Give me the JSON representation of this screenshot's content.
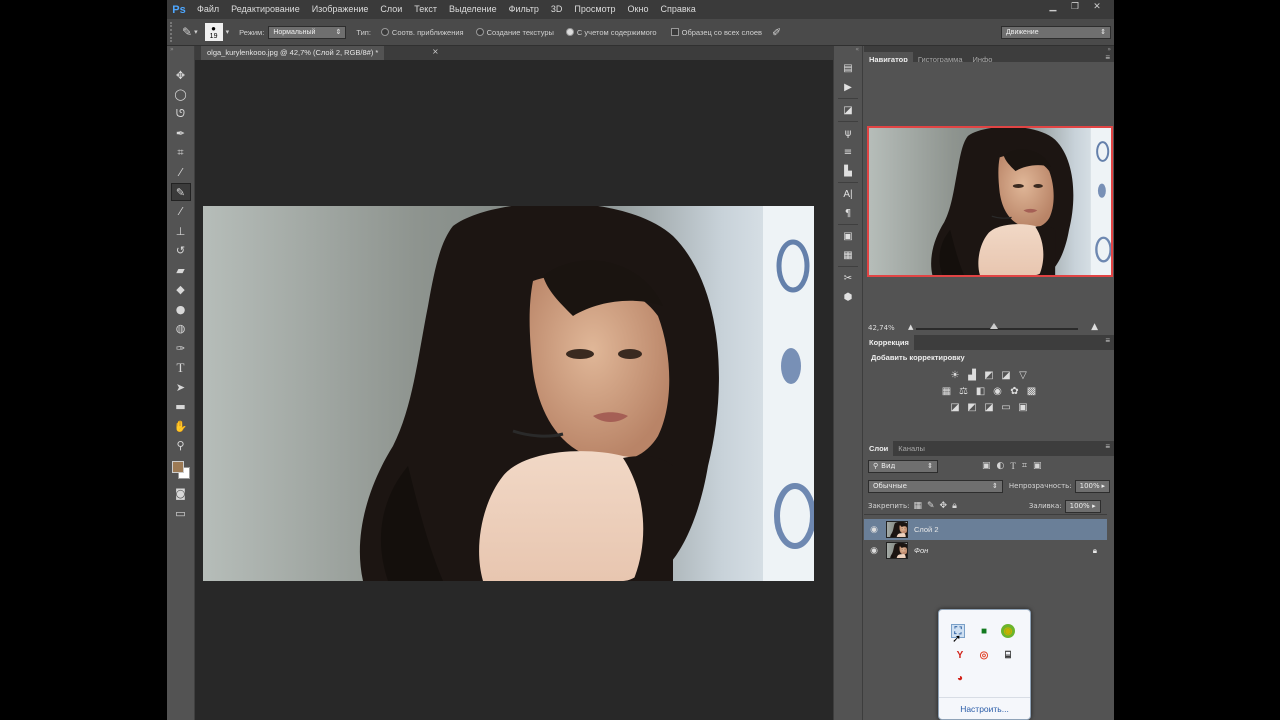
{
  "app": {
    "logo": "Ps"
  },
  "menu": [
    "Файл",
    "Редактирование",
    "Изображение",
    "Слои",
    "Текст",
    "Выделение",
    "Фильтр",
    "3D",
    "Просмотр",
    "Окно",
    "Справка"
  ],
  "options": {
    "brush_size": "19",
    "mode_label": "Режим:",
    "mode_value": "Нормальный",
    "type_label": "Тип:",
    "radio1": "Соотв. приближения",
    "radio2": "Создание текстуры",
    "radio3": "С учетом содержимого",
    "sample_all": "Образец со всех слоев",
    "workspace": "Движение"
  },
  "document": {
    "tab": "olga_kurylenkooo.jpg @ 42,7% (Слой 2, RGB/8#) *"
  },
  "navigator": {
    "tabs": [
      "Навигатор",
      "Гистограмма",
      "Инфо"
    ],
    "zoom": "42,74%"
  },
  "correction": {
    "tab": "Коррекция",
    "title": "Добавить корректировку"
  },
  "layers_panel": {
    "tabs": [
      "Слои",
      "Каналы"
    ],
    "filter": "Вид",
    "blend": "Обычные",
    "opacity_label": "Непрозрачность:",
    "opacity": "100%",
    "lock_label": "Закрепить:",
    "fill_label": "Заливка:",
    "fill": "100%",
    "layers": [
      {
        "name": "Слой 2",
        "selected": true
      },
      {
        "name": "Фон",
        "selected": false
      }
    ]
  },
  "tray": {
    "link": "Настроить..."
  },
  "colors": {
    "fg": "#9c7a55",
    "bg": "#ffffff",
    "selection": "#6a7f98",
    "nav_frame": "#e14444"
  }
}
